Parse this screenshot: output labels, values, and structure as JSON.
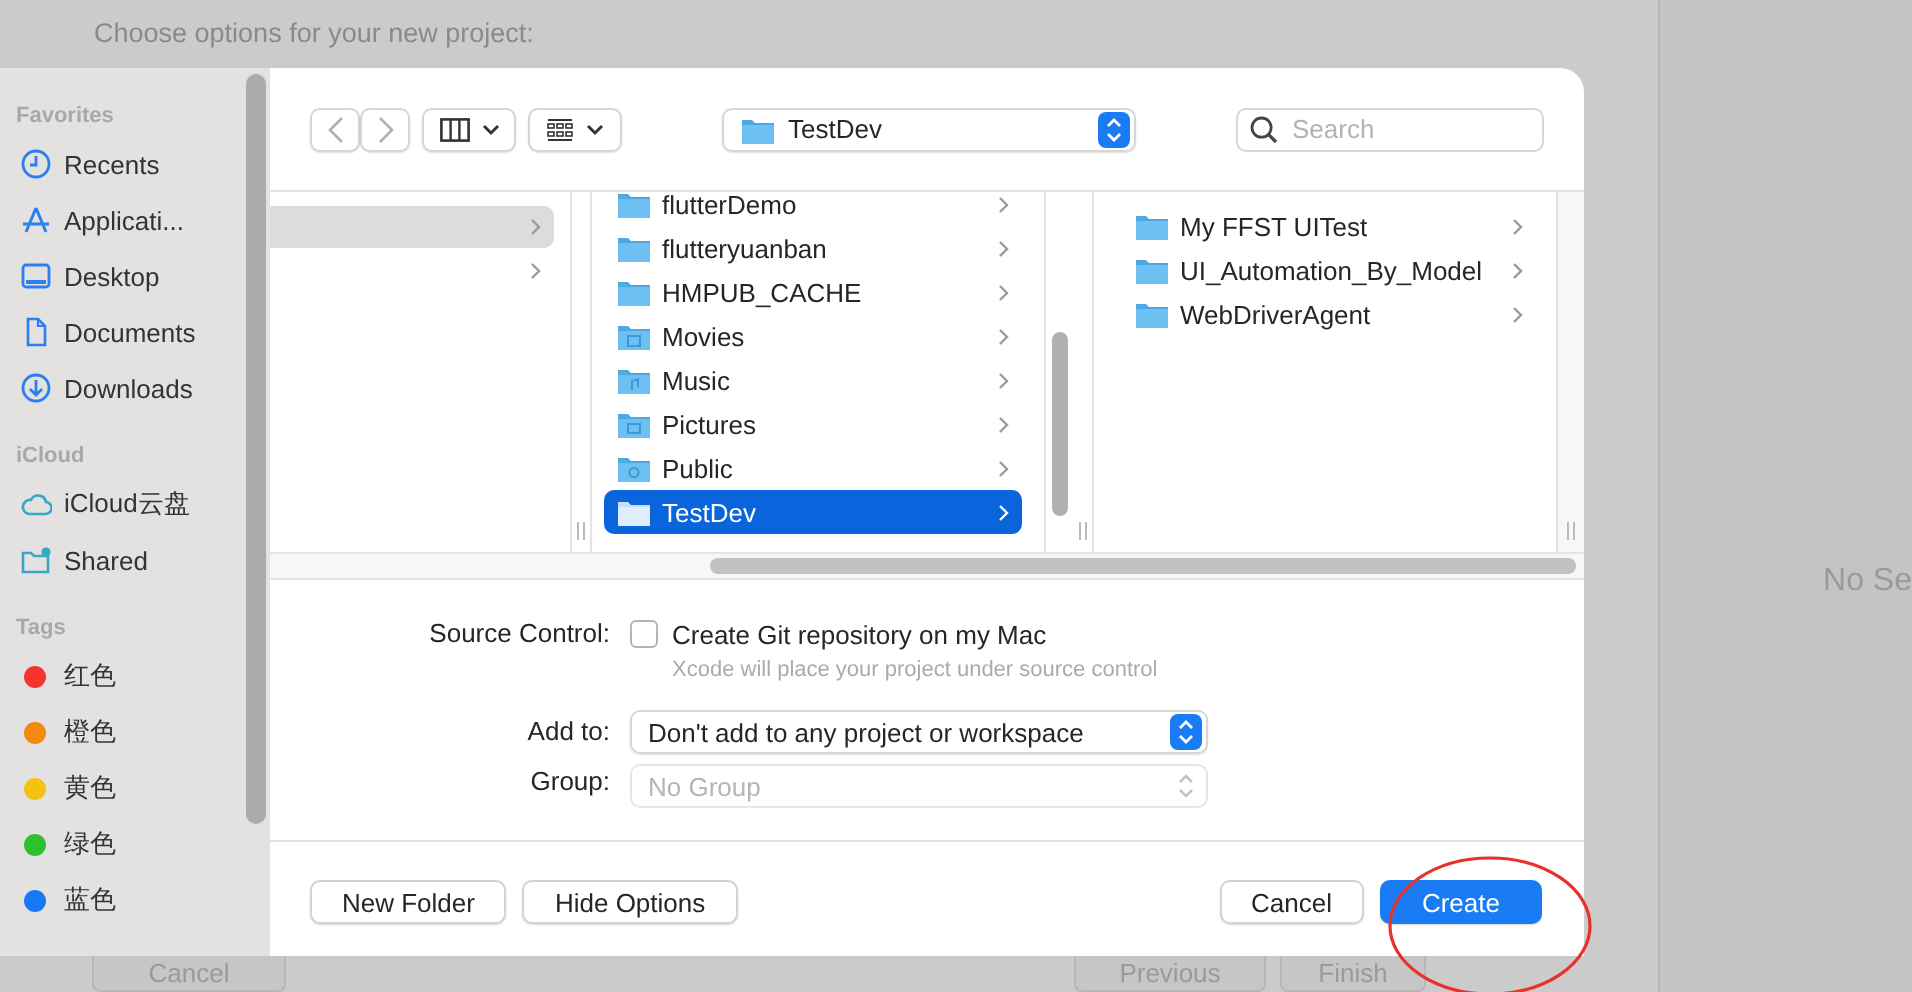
{
  "background_window": {
    "prompt": "Choose options for your new project:",
    "inspector_text": "No Se",
    "buttons": [
      {
        "label": "Cancel"
      },
      {
        "label": "Previous"
      },
      {
        "label": "Finish"
      }
    ]
  },
  "sidebar": {
    "sections": [
      {
        "title": "Favorites",
        "items": [
          {
            "label": "Recents",
            "kind": "clock"
          },
          {
            "label": "Applicati...",
            "kind": "apps"
          },
          {
            "label": "Desktop",
            "kind": "desktop"
          },
          {
            "label": "Documents",
            "kind": "document"
          },
          {
            "label": "Downloads",
            "kind": "download"
          }
        ]
      },
      {
        "title": "iCloud",
        "items": [
          {
            "label": "iCloud云盘",
            "kind": "cloud"
          },
          {
            "label": "Shared",
            "kind": "shared"
          }
        ]
      },
      {
        "title": "Tags",
        "items": [
          {
            "label": "红色",
            "kind": "tag",
            "color": "#f5342f"
          },
          {
            "label": "橙色",
            "kind": "tag",
            "color": "#f28a0f"
          },
          {
            "label": "黄色",
            "kind": "tag",
            "color": "#f5c211"
          },
          {
            "label": "绿色",
            "kind": "tag",
            "color": "#2dc22d"
          },
          {
            "label": "蓝色",
            "kind": "tag",
            "color": "#1877f5"
          }
        ]
      }
    ]
  },
  "toolbar": {
    "path": "TestDev",
    "search": {
      "placeholder": "Search"
    }
  },
  "browser": {
    "column_1": {
      "rows": [
        {
          "selected": true
        },
        {
          "selected": false
        }
      ]
    },
    "column_2": {
      "rows": [
        {
          "label": "flutterDemo",
          "kind": "folder",
          "selected": false
        },
        {
          "label": "flutteryuanban",
          "kind": "folder",
          "selected": false
        },
        {
          "label": "HMPUB_CACHE",
          "kind": "folder",
          "selected": false
        },
        {
          "label": "Movies",
          "kind": "movies",
          "selected": false
        },
        {
          "label": "Music",
          "kind": "music",
          "selected": false
        },
        {
          "label": "Pictures",
          "kind": "pictures",
          "selected": false
        },
        {
          "label": "Public",
          "kind": "public",
          "selected": false
        },
        {
          "label": "TestDev",
          "kind": "folder",
          "selected": true
        }
      ]
    },
    "column_3": {
      "rows": [
        {
          "label": "My FFST UITest",
          "kind": "folder",
          "selected": false
        },
        {
          "label": "UI_Automation_By_Model",
          "kind": "folder",
          "selected": false
        },
        {
          "label": "WebDriverAgent",
          "kind": "folder",
          "selected": false
        }
      ]
    }
  },
  "options": {
    "source_control": {
      "label": "Source Control:",
      "checkbox": {
        "label": "Create Git repository on my Mac",
        "checked": false
      },
      "hint": "Xcode will place your project under source control"
    },
    "add_to": {
      "label": "Add to:",
      "value": "Don't add to any project or workspace",
      "disabled": false
    },
    "group": {
      "label": "Group:",
      "value": "No Group",
      "disabled": true
    }
  },
  "footer": {
    "left_buttons": [
      {
        "label": "New Folder"
      },
      {
        "label": "Hide Options"
      }
    ],
    "right_buttons": [
      {
        "label": "Cancel",
        "kind": "default"
      },
      {
        "label": "Create",
        "kind": "primary"
      }
    ]
  }
}
